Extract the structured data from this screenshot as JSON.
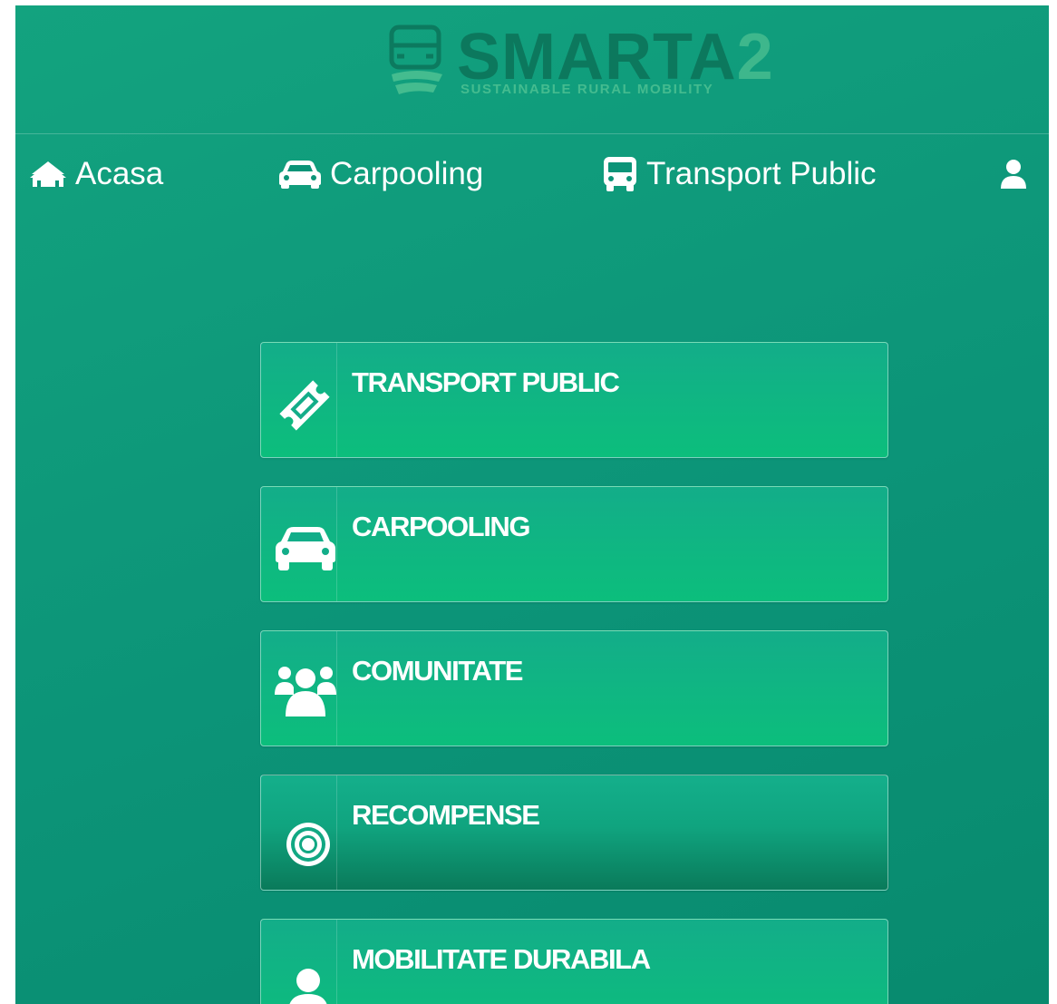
{
  "brand": {
    "name": "SMARTA",
    "name_suffix": "2",
    "tagline": "SUSTAINABLE RURAL MOBILITY"
  },
  "nav": {
    "items": [
      {
        "label": "Acasa",
        "icon": "houses-icon"
      },
      {
        "label": "Carpooling",
        "icon": "car-icon"
      },
      {
        "label": "Transport Public",
        "icon": "bus-icon"
      },
      {
        "label": "",
        "icon": "user-icon"
      }
    ]
  },
  "cards": [
    {
      "title": "TRANSPORT PUBLIC",
      "icon": "ticket-icon"
    },
    {
      "title": "CARPOOLING",
      "icon": "car-icon"
    },
    {
      "title": "COMUNITATE",
      "icon": "users-icon"
    },
    {
      "title": "RECOMPENSE",
      "icon": "target-icon"
    },
    {
      "title": "MOBILITATE DURABILA",
      "icon": "user-icon"
    }
  ],
  "colors": {
    "background": "#0c9478",
    "card": "#13ad89",
    "text": "#ffffff",
    "logo_dark": "#0b6e55",
    "logo_light": "#56c696"
  }
}
